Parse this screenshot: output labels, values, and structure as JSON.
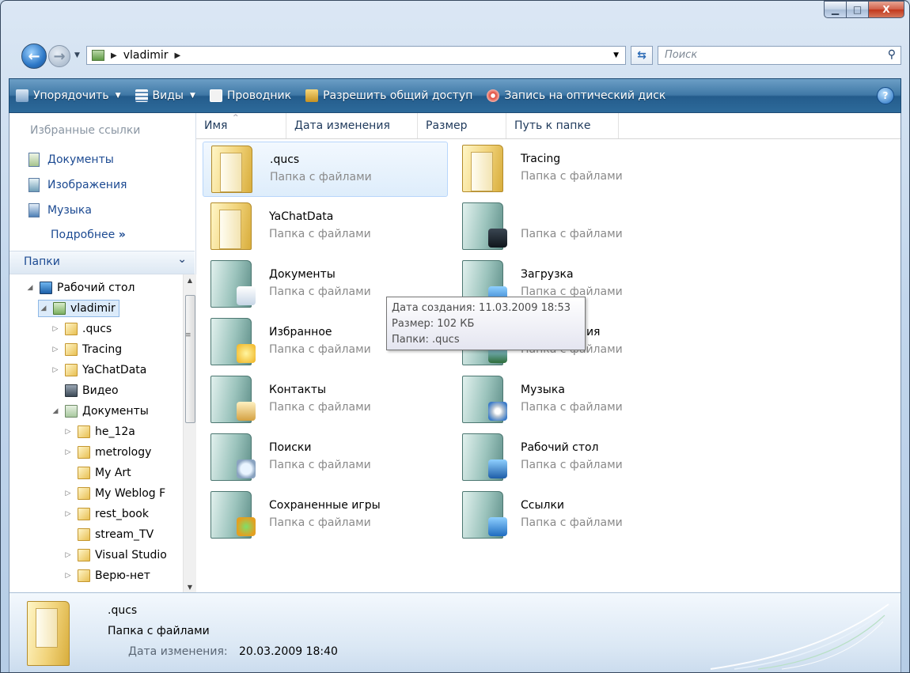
{
  "window": {
    "minimize_glyph": "▁",
    "maximize_glyph": "□",
    "close_glyph": "X"
  },
  "address": {
    "folder": "vladimir",
    "search_placeholder": "Поиск"
  },
  "toolbar": {
    "organize": "Упорядочить",
    "views": "Виды",
    "explorer": "Проводник",
    "share": "Разрешить общий доступ",
    "burn": "Запись на оптический диск",
    "help": "?"
  },
  "navpane": {
    "favorites_title": "Избранные ссылки",
    "favorites": [
      "Документы",
      "Изображения",
      "Музыка"
    ],
    "more": "Подробнее",
    "more_glyph": "»",
    "folders_title": "Папки"
  },
  "tree": [
    {
      "label": "Рабочий стол",
      "indent": 0,
      "arrow": "◢",
      "icon": "desktop"
    },
    {
      "label": "vladimir",
      "indent": 1,
      "arrow": "◢",
      "icon": "user",
      "selected": true
    },
    {
      "label": ".qucs",
      "indent": 2,
      "arrow": "▷",
      "icon": "folder"
    },
    {
      "label": "Tracing",
      "indent": 2,
      "arrow": "▷",
      "icon": "folder"
    },
    {
      "label": "YaChatData",
      "indent": 2,
      "arrow": "▷",
      "icon": "folder"
    },
    {
      "label": "Видео",
      "indent": 2,
      "arrow": "",
      "icon": "video"
    },
    {
      "label": "Документы",
      "indent": 2,
      "arrow": "◢",
      "icon": "doc"
    },
    {
      "label": "he_12a",
      "indent": 3,
      "arrow": "▷",
      "icon": "folder"
    },
    {
      "label": "metrology",
      "indent": 3,
      "arrow": "▷",
      "icon": "folder"
    },
    {
      "label": "My Art",
      "indent": 3,
      "arrow": "",
      "icon": "folder"
    },
    {
      "label": "My Weblog F",
      "indent": 3,
      "arrow": "▷",
      "icon": "folder"
    },
    {
      "label": "rest_book",
      "indent": 3,
      "arrow": "▷",
      "icon": "folder"
    },
    {
      "label": "stream_TV",
      "indent": 3,
      "arrow": "",
      "icon": "folder"
    },
    {
      "label": "Visual Studio",
      "indent": 3,
      "arrow": "▷",
      "icon": "folder"
    },
    {
      "label": "Верю-нет",
      "indent": 3,
      "arrow": "▷",
      "icon": "folder"
    }
  ],
  "columns": [
    "Имя",
    "Дата изменения",
    "Размер",
    "Путь к папке"
  ],
  "files": [
    {
      "name": ".qucs",
      "type": "Папка с файлами",
      "icon": "plain-folder",
      "hover": true
    },
    {
      "name": "Tracing",
      "type": "Папка с файлами",
      "icon": "plain-folder"
    },
    {
      "name": "YaChatData",
      "type": "Папка с файлами",
      "icon": "plain-folder"
    },
    {
      "name": "",
      "type": "Папка с файлами",
      "icon": "video-folder"
    },
    {
      "name": "Документы",
      "type": "Папка с файлами",
      "icon": "documents-folder"
    },
    {
      "name": "Загрузка",
      "type": "Папка с файлами",
      "icon": "downloads-folder"
    },
    {
      "name": "Избранное",
      "type": "Папка с файлами",
      "icon": "favorites-folder"
    },
    {
      "name": "Изображения",
      "type": "Папка с файлами",
      "icon": "pictures-folder"
    },
    {
      "name": "Контакты",
      "type": "Папка с файлами",
      "icon": "contacts-folder"
    },
    {
      "name": "Музыка",
      "type": "Папка с файлами",
      "icon": "music-folder"
    },
    {
      "name": "Поиски",
      "type": "Папка с файлами",
      "icon": "searches-folder"
    },
    {
      "name": "Рабочий стол",
      "type": "Папка с файлами",
      "icon": "desktop-folder"
    },
    {
      "name": "Сохраненные игры",
      "type": "Папка с файлами",
      "icon": "saved-games-folder"
    },
    {
      "name": "Ссылки",
      "type": "Папка с файлами",
      "icon": "links-folder"
    }
  ],
  "tooltip": {
    "created": "Дата создания: 11.03.2009 18:53",
    "size": "Размер: 102 КБ",
    "folders": "Папки: .qucs"
  },
  "details": {
    "name": ".qucs",
    "type": "Папка с файлами",
    "modified_label": "Дата изменения:",
    "modified_value": "20.03.2009 18:40"
  },
  "colors": {
    "toolbar": "#2d6a9a",
    "link": "#1c4a92",
    "selection": "#dcebfa"
  }
}
